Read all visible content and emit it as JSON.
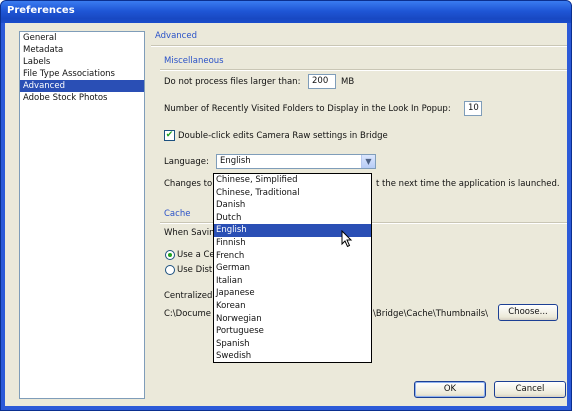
{
  "window": {
    "title": "Preferences"
  },
  "sidebar": {
    "items": [
      {
        "label": "General"
      },
      {
        "label": "Metadata"
      },
      {
        "label": "Labels"
      },
      {
        "label": "File Type Associations"
      },
      {
        "label": "Advanced",
        "selected": true
      },
      {
        "label": "Adobe Stock Photos"
      }
    ]
  },
  "panel": {
    "title": "Advanced",
    "misc": {
      "title": "Miscellaneous",
      "max_size_label": "Do not process files larger than:",
      "max_size_value": "200",
      "max_size_unit": "MB",
      "recent_folders_label": "Number of Recently Visited Folders to Display in the Look In Popup:",
      "recent_folders_value": "10",
      "camera_raw_label": "Double-click edits Camera Raw settings in Bridge",
      "camera_raw_checked": true,
      "language_label": "Language:",
      "language_value": "English",
      "changes_prefix": "Changes to",
      "changes_suffix": "t the next time the application is launched."
    },
    "cache": {
      "title": "Cache",
      "when_saving": "When Savin",
      "use_central": "Use a Ce",
      "use_distributed": "Use Distr",
      "centralized": "Centralized",
      "path_prefix": "C:\\Docume",
      "path_suffix": "\\Bridge\\Cache\\Thumbnails\\",
      "choose_label": "Choose..."
    }
  },
  "language_options": [
    {
      "label": "Chinese, Simplified"
    },
    {
      "label": "Chinese, Traditional"
    },
    {
      "label": "Danish"
    },
    {
      "label": "Dutch"
    },
    {
      "label": "English",
      "selected": true
    },
    {
      "label": "Finnish"
    },
    {
      "label": "French"
    },
    {
      "label": "German"
    },
    {
      "label": "Italian"
    },
    {
      "label": "Japanese"
    },
    {
      "label": "Korean"
    },
    {
      "label": "Norwegian"
    },
    {
      "label": "Portuguese"
    },
    {
      "label": "Spanish"
    },
    {
      "label": "Swedish"
    }
  ],
  "buttons": {
    "ok": "OK",
    "cancel": "Cancel"
  },
  "icons": {
    "check": "checkmark-icon",
    "arrow": "chevron-down-icon",
    "cursor": "mouse-cursor-icon"
  },
  "colors": {
    "titlebar": "#1f56d6",
    "selection": "#2a4fb5",
    "group_title": "#2a52c8",
    "face": "#ebe9da"
  }
}
